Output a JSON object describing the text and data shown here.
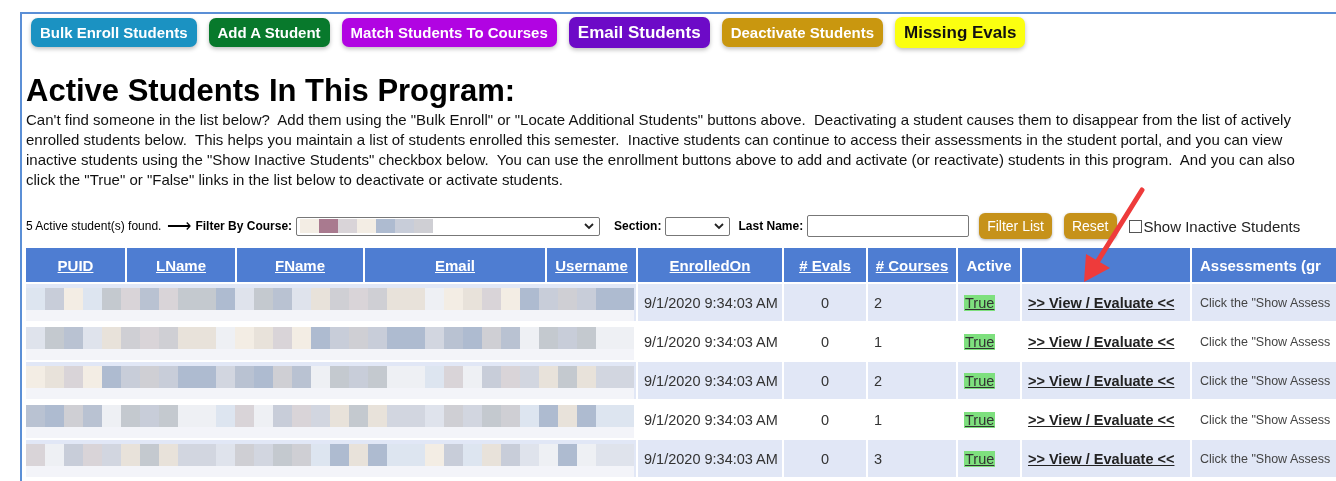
{
  "buttons": [
    {
      "label": "Bulk Enroll Students",
      "color": "#1b92c2",
      "kind": "standard"
    },
    {
      "label": "Add A Student",
      "color": "#08792c",
      "kind": "standard"
    },
    {
      "label": "Match Students To Courses",
      "color": "#b104e2",
      "kind": "standard"
    },
    {
      "label": "Email Students",
      "color": "#6d0ac7",
      "kind": "large"
    },
    {
      "label": "Deactivate Students",
      "color": "#c9970f",
      "kind": "standard"
    },
    {
      "label": "Missing Evals",
      "color": "#fbff10",
      "kind": "large"
    }
  ],
  "heading": "Active Students In This Program:",
  "description": "Can't find someone in the list below?  Add them using the \"Bulk Enroll\" or \"Locate Additional Students\" buttons above.  Deactivating a student causes them to disappear from the list of actively enrolled students below.  This helps you maintain a list of students enrolled this semester.  Inactive students can continue to access their assessments in the student portal, and you can view inactive students using the \"Show Inactive Students\" checkbox below.  You can use the enrollment buttons above to add and activate (or reactivate) students in this program.  And you can also click the \"True\" or \"False\" links in the list below to deactivate or activate students.",
  "filters": {
    "count": "5 Active student(s) found.",
    "arrow": "⟶",
    "course_label": "Filter By Course:",
    "section_label": "Section:",
    "last_name_label": "Last Name:",
    "filter_button": "Filter List",
    "reset_button": "Reset",
    "show_inactive": {
      "label": "Show Inactive Students",
      "checked": false
    }
  },
  "table": {
    "columns": [
      {
        "label": "PUID",
        "link": true
      },
      {
        "label": "LName",
        "link": true
      },
      {
        "label": "FName",
        "link": true
      },
      {
        "label": "Email",
        "link": true
      },
      {
        "label": "Username",
        "link": true
      },
      {
        "label": "EnrolledOn",
        "link": true
      },
      {
        "label": "# Evals",
        "link": true
      },
      {
        "label": "# Courses",
        "link": true
      },
      {
        "label": "Active",
        "link": false
      },
      {
        "label": "Assessments (gr",
        "link": false
      }
    ],
    "rows": [
      {
        "enrolled_on": "9/1/2020 9:34:03 AM",
        "evals": "0",
        "courses": "2",
        "active": "True",
        "action": ">> View / Evaluate <<",
        "assessments": "Click the \"Show Assess"
      },
      {
        "enrolled_on": "9/1/2020 9:34:03 AM",
        "evals": "0",
        "courses": "1",
        "active": "True",
        "action": ">> View / Evaluate <<",
        "assessments": "Click the \"Show Assess"
      },
      {
        "enrolled_on": "9/1/2020 9:34:03 AM",
        "evals": "0",
        "courses": "2",
        "active": "True",
        "action": ">> View / Evaluate <<",
        "assessments": "Click the \"Show Assess"
      },
      {
        "enrolled_on": "9/1/2020 9:34:03 AM",
        "evals": "0",
        "courses": "1",
        "active": "True",
        "action": ">> View / Evaluate <<",
        "assessments": "Click the \"Show Assess"
      },
      {
        "enrolled_on": "9/1/2020 9:34:03 AM",
        "evals": "0",
        "courses": "3",
        "active": "True",
        "action": ">> View / Evaluate <<",
        "assessments": "Click the \"Show Assess"
      }
    ]
  }
}
